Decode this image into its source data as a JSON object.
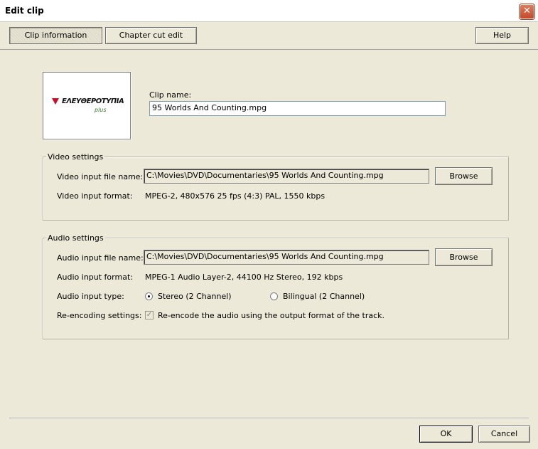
{
  "window": {
    "title": "Edit clip",
    "close_glyph": "✕"
  },
  "tabs": {
    "clip_information": "Clip information",
    "chapter_cut_edit": "Chapter cut edit"
  },
  "help_label": "Help",
  "thumbnail": {
    "logo_text": "ΕΛΕΥΘΕΡΟΤΥΠΙΑ",
    "logo_sub": "plus"
  },
  "clip_name": {
    "label": "Clip name:",
    "value": "95 Worlds And Counting.mpg"
  },
  "video_settings": {
    "title": "Video settings",
    "file_label": "Video input file name:",
    "file_value": "C:\\Movies\\DVD\\Documentaries\\95 Worlds And Counting.mpg",
    "browse_label": "Browse",
    "format_label": "Video input format:",
    "format_value": "MPEG-2, 480x576 25 fps (4:3) PAL, 1550 kbps"
  },
  "audio_settings": {
    "title": "Audio settings",
    "file_label": "Audio input file name:",
    "file_value": "C:\\Movies\\DVD\\Documentaries\\95 Worlds And Counting.mpg",
    "browse_label": "Browse",
    "format_label": "Audio input format:",
    "format_value": "MPEG-1 Audio Layer-2, 44100 Hz Stereo, 192 kbps",
    "type_label": "Audio input type:",
    "type_options": [
      "Stereo (2 Channel)",
      "Bilingual (2 Channel)"
    ],
    "type_selected": "Stereo (2 Channel)",
    "reencode_label": "Re-encoding settings:",
    "reencode_checkbox_label": "Re-encode the audio using the output format of the track.",
    "reencode_checked": true
  },
  "footer": {
    "ok_label": "OK",
    "cancel_label": "Cancel"
  }
}
